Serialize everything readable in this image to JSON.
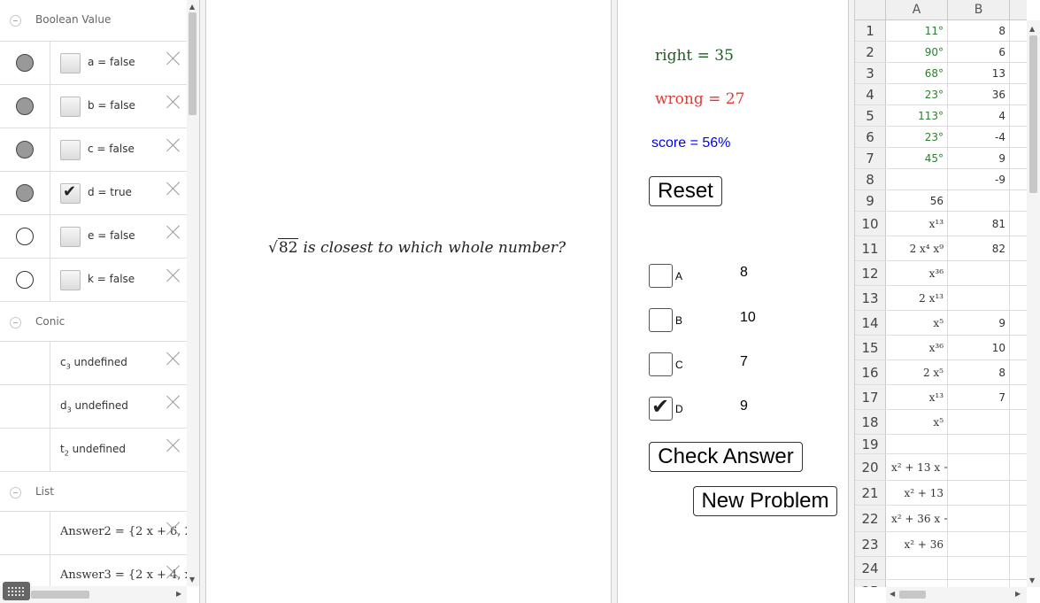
{
  "algebra": {
    "groups": {
      "boolean": "Boolean Value",
      "conic": "Conic",
      "list": "List"
    },
    "booleans": [
      {
        "text": "a = false",
        "checked": false,
        "dot": "filled"
      },
      {
        "text": "b = false",
        "checked": false,
        "dot": "filled"
      },
      {
        "text": "c = false",
        "checked": false,
        "dot": "filled"
      },
      {
        "text": "d = true",
        "checked": true,
        "dot": "filled"
      },
      {
        "text": "e = false",
        "checked": false,
        "dot": "empty"
      },
      {
        "text": "k = false",
        "checked": false,
        "dot": "empty"
      }
    ],
    "conics": [
      {
        "name": "c",
        "sub": "3",
        "text": " undefined"
      },
      {
        "name": "d",
        "sub": "3",
        "text": " undefined"
      },
      {
        "name": "t",
        "sub": "2",
        "text": " undefined"
      }
    ],
    "lists": [
      {
        "text": "Answer2 = {2 x + 6, 2x"
      },
      {
        "text": "Answer3 = {2 x + 4, x³⁶"
      }
    ]
  },
  "question": {
    "radicand": "82",
    "text": "is closest to which whole number?"
  },
  "stats": {
    "right": "right = 35",
    "wrong": "wrong = 27",
    "score": "score = 56%"
  },
  "buttons": {
    "reset": "Reset",
    "check": "Check Answer",
    "new": "New Problem"
  },
  "choices": [
    {
      "letter": "A",
      "value": "8",
      "checked": false
    },
    {
      "letter": "B",
      "value": "10",
      "checked": false
    },
    {
      "letter": "C",
      "value": "7",
      "checked": false
    },
    {
      "letter": "D",
      "value": "9",
      "checked": true
    }
  ],
  "spreadsheet": {
    "columns": [
      "A",
      "B"
    ],
    "rows": [
      {
        "n": "1",
        "a": "11°",
        "b": "8",
        "green": true
      },
      {
        "n": "2",
        "a": "90°",
        "b": "6",
        "green": true
      },
      {
        "n": "3",
        "a": "68°",
        "b": "13",
        "green": true
      },
      {
        "n": "4",
        "a": "23°",
        "b": "36",
        "green": true
      },
      {
        "n": "5",
        "a": "113°",
        "b": "4",
        "green": true
      },
      {
        "n": "6",
        "a": "23°",
        "b": "-4",
        "green": true
      },
      {
        "n": "7",
        "a": "45°",
        "b": "9",
        "green": true
      },
      {
        "n": "8",
        "a": "",
        "b": "-9"
      },
      {
        "n": "9",
        "a": "56",
        "b": ""
      },
      {
        "n": "10",
        "a": "x¹³",
        "b": "81",
        "formula": true
      },
      {
        "n": "11",
        "a": "2 x⁴ x⁹",
        "b": "82",
        "formula": true
      },
      {
        "n": "12",
        "a": "x³⁶",
        "b": "",
        "formula": true
      },
      {
        "n": "13",
        "a": "2 x¹³",
        "b": "",
        "formula": true
      },
      {
        "n": "14",
        "a": "x⁵",
        "b": "9",
        "formula": true
      },
      {
        "n": "15",
        "a": "x³⁶",
        "b": "10",
        "formula": true
      },
      {
        "n": "16",
        "a": "2 x⁵",
        "b": "8",
        "formula": true
      },
      {
        "n": "17",
        "a": "x¹³",
        "b": "7",
        "formula": true
      },
      {
        "n": "18",
        "a": "x⁵",
        "b": "",
        "formula": true
      },
      {
        "n": "19",
        "a": "",
        "b": ""
      },
      {
        "n": "20",
        "a": "x² + 13 x + 3",
        "b": "",
        "formula": true,
        "left": true
      },
      {
        "n": "21",
        "a": "x² + 13",
        "b": "",
        "formula": true
      },
      {
        "n": "22",
        "a": "x² + 36 x + 3",
        "b": "",
        "formula": true,
        "left": true
      },
      {
        "n": "23",
        "a": "x² + 36",
        "b": "",
        "formula": true
      },
      {
        "n": "24",
        "a": "",
        "b": ""
      },
      {
        "n": "25",
        "a": "",
        "b": ""
      }
    ]
  },
  "colors": {
    "right": "#1b5e20",
    "wrong": "#e53935",
    "score": "#0000ff",
    "green_cells": "#2e7d32"
  }
}
